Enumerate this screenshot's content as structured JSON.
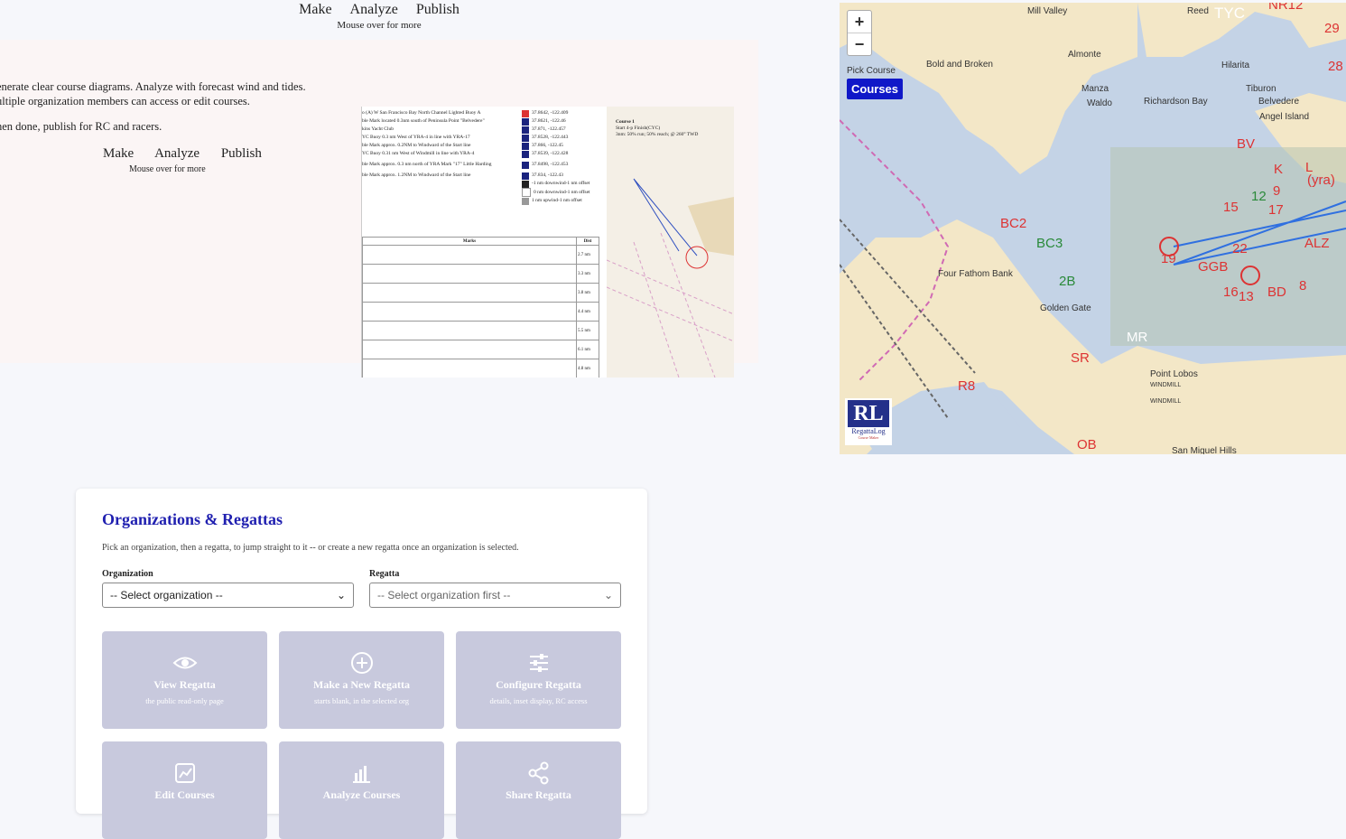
{
  "topnav": {
    "make": "Make",
    "analyze": "Analyze",
    "publish": "Publish",
    "hint": "Mouse over for more"
  },
  "hero": {
    "line1": "enerate clear course diagrams. Analyze with forecast wind and tides.",
    "line2": "ultiple organization members can access or edit courses.",
    "line3": "hen done, publish for RC and racers.",
    "make": "Make",
    "analyze": "Analyze",
    "publish": "Publish",
    "hint": "Mouse over for more"
  },
  "preview": {
    "marks": [
      "o (A) W San Francisco Bay North Channel Lighted Buoy A",
      "ble Mark located 0.3nm south of Peninsula Point \"Belvedere\"",
      "kins Yacht Club",
      "YC Buoy 0.3 nm West of YRA-4 in line with YRA-17",
      "ble Mark approx. 0.2NM to Windward of the Start line",
      "YC Buoy 0.31 nm West of Windmill in line with YRA-4",
      "ble Mark approx. 0.3 nm north of YRA Mark \"17\" Little Harding",
      "ble Mark approx. 1.2NM to Windward of the Start line"
    ],
    "coords": [
      "37.8642, -122.409",
      "37.8621, -122.46",
      "37.871, -122.457",
      "37.8528, -122.443",
      "37.866, -122.45",
      "37.8539, -122.428",
      "37.8498, -122.453",
      "37.834, -122.43"
    ],
    "offsets": [
      "-1 nm downwind-1 nm offset",
      "0 nm downwind-1 nm offset",
      "1 nm upwind-1 nm offset"
    ],
    "table_header": {
      "marks": "Marks",
      "dist": "Dist"
    },
    "distances": [
      "2.7 nm",
      "3.3 nm",
      "3.8 nm",
      "4.4 nm",
      "5.5 nm",
      "6.1 nm",
      "4.8 nm"
    ],
    "course_title": "Course 1",
    "course_line1": "Start 4-p Finish(CYC)",
    "course_line2": "3nm: 50% run; 50% reach; @ 260° TWD"
  },
  "map": {
    "zoom_in": "+",
    "zoom_out": "−",
    "pick_course": "Pick Course",
    "courses_button": "Courses",
    "logo_text": "RL",
    "logo_sub": "RegattaLog",
    "logo_tiny": "Course Maker",
    "labels": {
      "mill_valley": "Mill Valley",
      "reed": "Reed",
      "almonte": "Almonte",
      "bold_broken": "Bold and Broken",
      "hilarita": "Hilarita",
      "tiburon": "Tiburon",
      "belvedere": "Belvedere",
      "manza": "Manza",
      "waldo": "Waldo",
      "richardson_bay": "Richardson Bay",
      "angel_island": "Angel Island",
      "four_fathom": "Four Fathom Bank",
      "golden_gate": "Golden Gate",
      "point_lobos": "Point Lobos",
      "windmill1": "WINDMILL",
      "windmill2": "WINDMILL",
      "san_miguel": "San Miguel Hills"
    },
    "marks": {
      "tyc": "TYC",
      "nr12": "NR12",
      "n29": "29",
      "n28": "28",
      "bv": "BV",
      "k": "K",
      "l": "L",
      "yra": "(yra)",
      "n12": "12",
      "n9": "9",
      "n15": "15",
      "n17": "17",
      "n22": "22",
      "alz": "ALZ",
      "n19": "19",
      "ggb": "GGB",
      "n16": "16",
      "n13": "13",
      "bd": "BD",
      "n8": "8",
      "bc2": "BC2",
      "bc3": "BC3",
      "sr": "SR",
      "r8": "R8",
      "ob": "OB",
      "mr": "MR",
      "n2b": "2B"
    }
  },
  "org": {
    "title": "Organizations & Regattas",
    "desc": "Pick an organization, then a regatta, to jump straight to it -- or create a new regatta once an organization is selected.",
    "org_label": "Organization",
    "org_value": "-- Select organization --",
    "regatta_label": "Regatta",
    "regatta_value": "-- Select organization first --",
    "tiles": [
      {
        "title": "View Regatta",
        "sub": "the public read-only page",
        "icon": "eye-icon"
      },
      {
        "title": "Make a New Regatta",
        "sub": "starts blank, in the selected org",
        "icon": "plus-circle-icon"
      },
      {
        "title": "Configure Regatta",
        "sub": "details, inset display, RC access",
        "icon": "sliders-icon"
      },
      {
        "title": "Edit Courses",
        "sub": "",
        "icon": "chart-line-icon"
      },
      {
        "title": "Analyze Courses",
        "sub": "",
        "icon": "bar-chart-icon"
      },
      {
        "title": "Share Regatta",
        "sub": "",
        "icon": "share-icon"
      }
    ]
  }
}
